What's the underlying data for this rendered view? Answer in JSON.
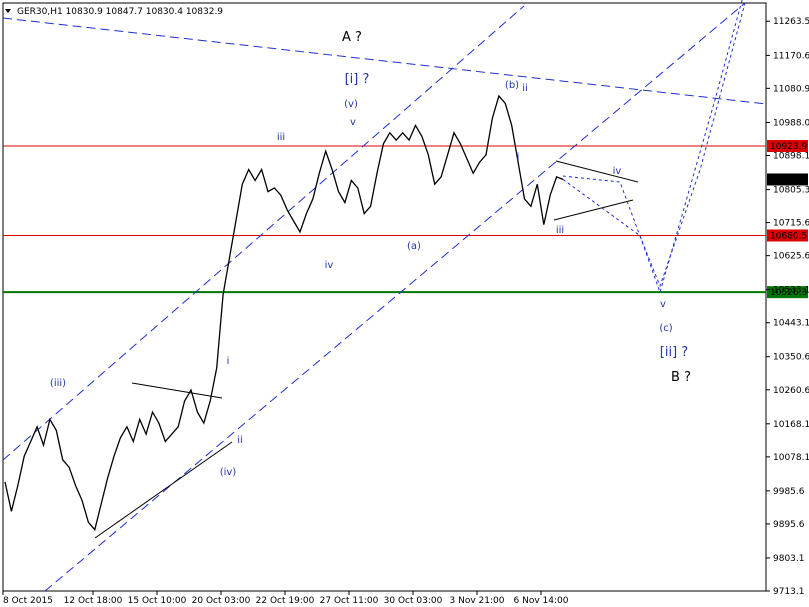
{
  "header": {
    "symbol_label": "GER30,H1  10830.9 10847.7 10830.4 10832.9"
  },
  "colors": {
    "background": "#ffffff",
    "price_line": "#000000",
    "channel": "#1f2fd0",
    "resistance": "#dd0000",
    "support": "#007700",
    "label_blue": "#2233aa"
  },
  "chart_data": {
    "type": "line",
    "title": "",
    "xlabel": "",
    "ylabel": "",
    "instrument": "GER30",
    "timeframe": "H1",
    "quote": {
      "open": 10830.9,
      "high": 10847.7,
      "low": 10830.4,
      "close": 10832.9
    },
    "ylim": [
      9713.1,
      11350
    ],
    "x_tick_labels": [
      "8 Oct 2015",
      "12 Oct 18:00",
      "15 Oct 10:00",
      "20 Oct 03:00",
      "22 Oct 19:00",
      "27 Oct 11:00",
      "30 Oct 03:00",
      "3 Nov 21:00",
      "6 Nov 14:00"
    ],
    "y_tick_labels": [
      "11263.5",
      "11170.6",
      "11080.9",
      "10988.0",
      "10898.1",
      "10805.3",
      "10715.6",
      "10625.6",
      "10533.1",
      "10443.1",
      "10350.6",
      "10260.6",
      "10168.1",
      "10078.1",
      "9985.6",
      "9895.6",
      "9803.1",
      "9713.1"
    ],
    "series": [
      {
        "values": [
          10010,
          9930,
          10000,
          10080,
          10120,
          10160,
          10110,
          10180,
          10150,
          10070,
          10050,
          10000,
          9960,
          9900,
          9880,
          9950,
          10020,
          10080,
          10130,
          10160,
          10120,
          10180,
          10140,
          10200,
          10170,
          10120,
          10140,
          10160,
          10230,
          10260,
          10200,
          10170,
          10230,
          10320,
          10520,
          10620,
          10720,
          10820,
          10860,
          10830,
          10860,
          10800,
          10810,
          10790,
          10750,
          10720,
          10690,
          10740,
          10780,
          10850,
          10910,
          10860,
          10800,
          10770,
          10830,
          10810,
          10740,
          10760,
          10850,
          10930,
          10960,
          10940,
          10960,
          10940,
          10980,
          10950,
          10900,
          10820,
          10840,
          10900,
          10960,
          10930,
          10890,
          10850,
          10880,
          10900,
          11000,
          11060,
          11040,
          10980,
          10880,
          10780,
          10760,
          10820,
          10710,
          10790,
          10840,
          10833
        ]
      }
    ],
    "horizontal_levels": [
      {
        "value": 10923.9,
        "label": "10923.9",
        "color": "#dd0000"
      },
      {
        "value": 10680.5,
        "label": "10680.5",
        "color": "#dd0000"
      },
      {
        "value": 10526.3,
        "label": "10526.3",
        "color": "#007700"
      }
    ],
    "current_price_label": "10832.9",
    "forecast_path": [
      {
        "value": 10833
      },
      {
        "value": 10680
      },
      {
        "value": 10526
      },
      {
        "value": 11050
      },
      {
        "value": 11350
      }
    ],
    "wave_labels": [
      {
        "text": "(iii)",
        "style": "wave"
      },
      {
        "text": "i",
        "style": "wave"
      },
      {
        "text": "ii",
        "style": "wave"
      },
      {
        "text": "(iv)",
        "style": "wave"
      },
      {
        "text": "iii",
        "style": "wave"
      },
      {
        "text": "(v)",
        "style": "wave"
      },
      {
        "text": "v",
        "style": "wave"
      },
      {
        "text": "iv",
        "style": "wave"
      },
      {
        "text": "(a)",
        "style": "wave"
      },
      {
        "text": "(b)",
        "style": "wave"
      },
      {
        "text": "ii",
        "style": "wave"
      },
      {
        "text": "i",
        "style": "wave"
      },
      {
        "text": "iv",
        "style": "wave"
      },
      {
        "text": "iii",
        "style": "wave"
      },
      {
        "text": "v",
        "style": "wave"
      },
      {
        "text": "(c)",
        "style": "wave"
      },
      {
        "text": "[i] ?",
        "style": "big-blue"
      },
      {
        "text": "[ii] ?",
        "style": "big-blue"
      },
      {
        "text": "A ?",
        "style": "big"
      },
      {
        "text": "B ?",
        "style": "big"
      }
    ]
  }
}
